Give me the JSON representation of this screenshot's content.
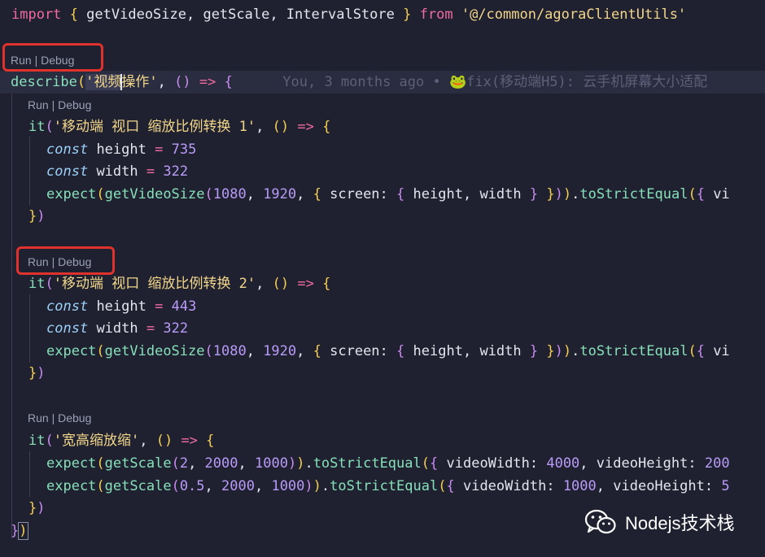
{
  "imports": {
    "keyword": "import",
    "names": "getVideoSize, getScale, IntervalStore",
    "from_kw": "from",
    "path": "'@/common/agoraClientUtils'"
  },
  "codelens": {
    "run": "Run",
    "sep": " | ",
    "debug": "Debug"
  },
  "describe": {
    "fn": "describe",
    "name_pre": "'视频",
    "name_post": "操作'",
    "blame": "You, 3 months ago • 🐸fix(移动端H5): 云手机屏幕大小适配"
  },
  "tests": [
    {
      "fn": "it",
      "name": "'移动端 视口 缩放比例转换 1'",
      "height": "735",
      "width": "322",
      "call": {
        "fn": "getVideoSize",
        "a": "1080",
        "b": "1920",
        "screen": "screen",
        "height": "height",
        "width": "width",
        "assert": "toStrictEqual",
        "tail": "vi"
      }
    },
    {
      "fn": "it",
      "name": "'移动端 视口 缩放比例转换 2'",
      "height": "443",
      "width": "322",
      "call": {
        "fn": "getVideoSize",
        "a": "1080",
        "b": "1920",
        "screen": "screen",
        "height": "height",
        "width": "width",
        "assert": "toStrictEqual",
        "tail": "vi"
      }
    }
  ],
  "scale_test": {
    "fn": "it",
    "name": "'宽高缩放缩'",
    "rows": [
      {
        "fn": "getScale",
        "a": "2",
        "b": "2000",
        "c": "1000",
        "assert": "toStrictEqual",
        "k1": "videoWidth",
        "v1": "4000",
        "k2": "videoHeight",
        "v2": "200"
      },
      {
        "fn": "getScale",
        "a": "0.5",
        "b": "2000",
        "c": "1000",
        "assert": "toStrictEqual",
        "k1": "videoWidth",
        "v1": "1000",
        "k2": "videoHeight",
        "v2": "5"
      }
    ]
  },
  "keywords": {
    "const": "const",
    "height": "height",
    "width": "width",
    "expect": "expect"
  },
  "watermark": {
    "text": "Nodejs技术栈",
    "icon": "wechat-icon"
  }
}
